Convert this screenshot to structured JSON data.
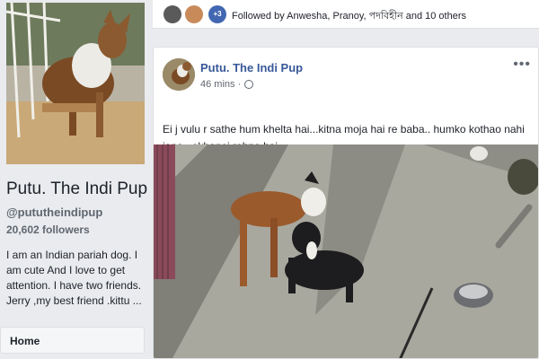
{
  "page": {
    "name": "Putu. The Indi Pup",
    "handle": "@pututheindipup",
    "followers": "20,602 followers",
    "about": "I am an Indian pariah dog. I am cute And I love to get attention. I have two friends. Jerry ,my best friend .kittu ..."
  },
  "nav": {
    "home_label": "Home"
  },
  "followed": {
    "more_badge": "+3",
    "text": "Followed by Anwesha, Pranoy, পদবিহীন and 10 others"
  },
  "post": {
    "author": "Putu. The Indi Pup",
    "time": "46 mins ·",
    "privacy_icon": "globe-icon",
    "more_icon": "more-options-icon",
    "more_glyph": "•••",
    "text": "Ei j vulu r sathe hum khelta hai...kitna moja hai re baba.. humko kothao nahi jana.. ekhanei rehna hai"
  },
  "colors": {
    "link": "#385898",
    "brand": "#4267b2",
    "background": "#e9ebee"
  }
}
